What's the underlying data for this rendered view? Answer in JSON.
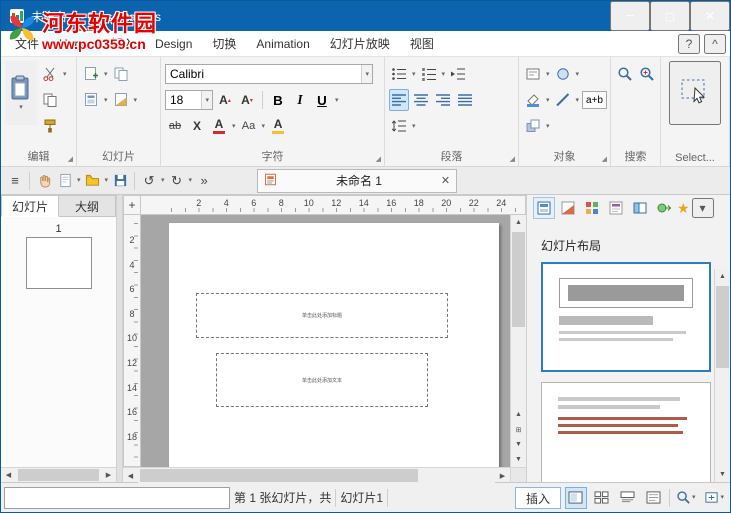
{
  "watermark": {
    "site_name": "河东软件园",
    "site_url": "www.pc0359.cn"
  },
  "titlebar": {
    "title": "未命名 1 - Presentations"
  },
  "glyphs": {
    "minimize": "─",
    "maximize": "▢",
    "close": "✕",
    "dropdown": "▾",
    "up": "▲",
    "down": "▼",
    "left": "◀",
    "right": "▶",
    "undo": "↺",
    "redo": "↻",
    "more": "»",
    "hamburger": "≡",
    "launcher": "◢",
    "help": "?",
    "collapse": "^",
    "star": "★",
    "plus": "+",
    "tri_up": "▴",
    "tri_down": "▾",
    "split": "⊞"
  },
  "menubar": {
    "tabs": [
      {
        "label": "文件"
      },
      {
        "label": "Home",
        "active": true
      },
      {
        "label": "插入"
      },
      {
        "label": "Design"
      },
      {
        "label": "切换"
      },
      {
        "label": "Animation"
      },
      {
        "label": "幻灯片放映"
      },
      {
        "label": "视图"
      }
    ]
  },
  "ribbon": {
    "groups": {
      "edit": "编辑",
      "slides": "幻灯片",
      "character": "字符",
      "paragraph": "段落",
      "objects": "对象",
      "search": "搜索",
      "select": "Select..."
    },
    "font_name": "Calibri",
    "font_size": "18",
    "buttons": {
      "grow": "A",
      "shrink": "A",
      "bold": "B",
      "italic": "I",
      "underline": "U",
      "strikethrough": "ab",
      "superscript": "X",
      "font_color": "A",
      "change_case": "Aa",
      "highlight": "A",
      "merge": "a+b"
    }
  },
  "quickbar": {
    "document_tab": "未命名 1"
  },
  "left_panel": {
    "tabs": [
      {
        "label": "幻灯片",
        "active": true
      },
      {
        "label": "大纲"
      }
    ],
    "slide_number": "1"
  },
  "ruler": {
    "h": [
      "2",
      "4",
      "6",
      "8",
      "10",
      "12",
      "14",
      "16",
      "18",
      "20",
      "22",
      "24"
    ],
    "v": [
      "2",
      "4",
      "6",
      "8",
      "10",
      "12",
      "14",
      "16",
      "18"
    ]
  },
  "slide": {
    "title_placeholder": "单击此处添加标题",
    "body_placeholder": "单击此处添加文本"
  },
  "right_panel": {
    "title": "幻灯片布局"
  },
  "statusbar": {
    "slide_info": "第 1 张幻灯片，共",
    "slide_name": "幻灯片1",
    "insert_mode": "插入"
  },
  "colors": {
    "titlebar": "#0b64ad",
    "accent": "#2a7cc4",
    "selection": "#cfe6fb"
  }
}
